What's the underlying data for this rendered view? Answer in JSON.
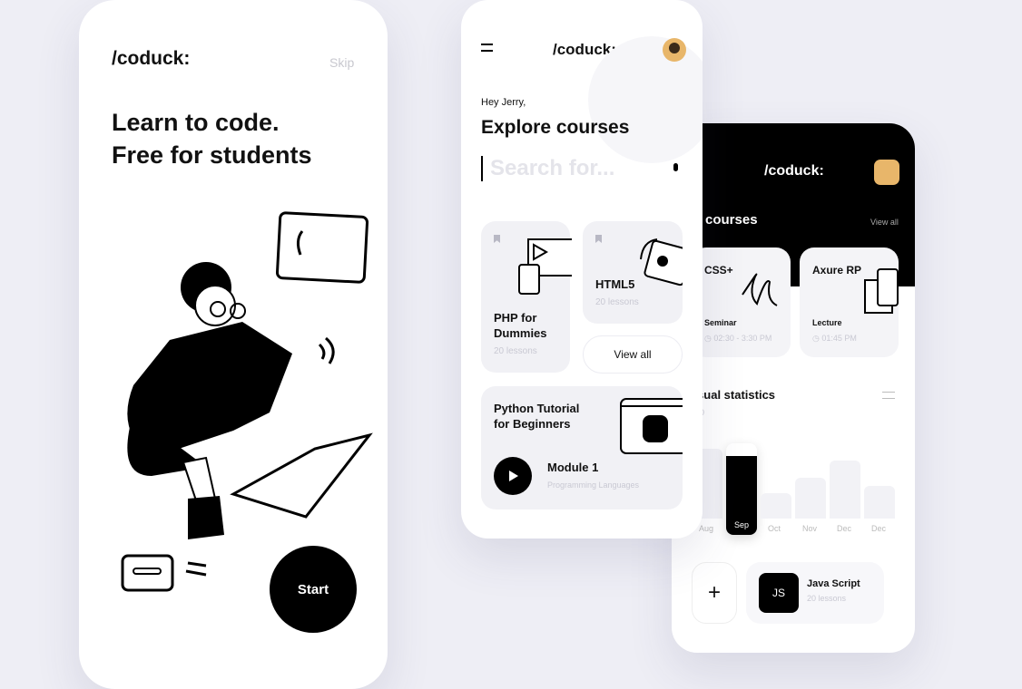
{
  "screen1": {
    "logo": "/coduck:",
    "skip": "Skip",
    "headline1": "Learn to code.",
    "headline2": "Free for students",
    "start": "Start"
  },
  "screen2": {
    "logo": "/coduck:",
    "greeting": "Hey Jerry,",
    "title": "Explore courses",
    "search_placeholder": "Search for...",
    "courses": [
      {
        "title1": "PHP for",
        "title2": "Dummies",
        "lessons": "20 lessons"
      },
      {
        "title1": "HTML5",
        "lessons": "20 lessons"
      }
    ],
    "view_all": "View all",
    "featured": {
      "title1": "Python Tutorial",
      "title2": "for Beginners",
      "module": "Module 1",
      "category": "Programming Languages"
    }
  },
  "screen3": {
    "logo": "/coduck:",
    "section": "My courses",
    "view_all": "View all",
    "courses": [
      {
        "title": "CSS+",
        "type": "Seminar",
        "time": "02:30 - 3:30 PM"
      },
      {
        "title": "Axure RP",
        "type": "Lecture",
        "time": "01:45 PM"
      }
    ],
    "stats_title": "Visual statistics",
    "stats_sub": "2020",
    "chart_data": {
      "type": "bar",
      "categories": [
        "Aug",
        "Sep",
        "Oct",
        "Nov",
        "Dec",
        "Dec"
      ],
      "values": [
        55,
        72,
        20,
        32,
        46,
        26
      ],
      "highlight": "Sep"
    },
    "bottom": {
      "add": "+",
      "badge": "JS",
      "title": "Java Script",
      "lessons": "20 lessons"
    }
  }
}
